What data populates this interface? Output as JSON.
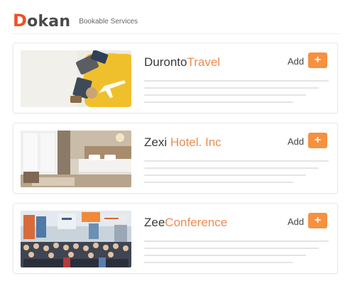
{
  "brand": {
    "logo_first": "D",
    "logo_rest": "okan",
    "subtitle": "Bookable Services"
  },
  "colors": {
    "accent": "#f5913f",
    "logo": "#f05025",
    "title_accent": "#f08a50"
  },
  "services": [
    {
      "name_main": "Duronto",
      "name_accent": "Travel",
      "add_label": "Add",
      "add_icon": "+",
      "image": "travel-suitcase-photo"
    },
    {
      "name_main": "Zexi ",
      "name_accent": "Hotel. Inc",
      "add_label": "Add",
      "add_icon": "+",
      "image": "hotel-room-photo"
    },
    {
      "name_main": "Zee",
      "name_accent": "Conference",
      "add_label": "Add",
      "add_icon": "+",
      "image": "conference-crowd-photo"
    }
  ]
}
